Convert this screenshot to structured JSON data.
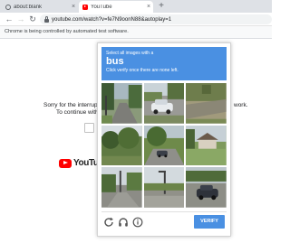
{
  "browser": {
    "tabs": [
      {
        "label": "about:blank"
      },
      {
        "label": "YouTube"
      }
    ],
    "new_tab_label": "+",
    "url": "youtube.com/watch?v=fe7N9oonN88&autoplay=1",
    "infobar": "Chrome is being controlled by automated test software."
  },
  "page": {
    "sorry_line": "Sorry for the interruption. We have",
    "continue_line": "To continue with your Y",
    "network_fragment": "work.",
    "logo_word": "YouTube"
  },
  "captcha": {
    "instruction": "Select all images with a",
    "target": "bus",
    "sub_instruction": "Click verify once there are none left.",
    "verify_label": "VERIFY",
    "accent_color": "#4a90e2"
  }
}
